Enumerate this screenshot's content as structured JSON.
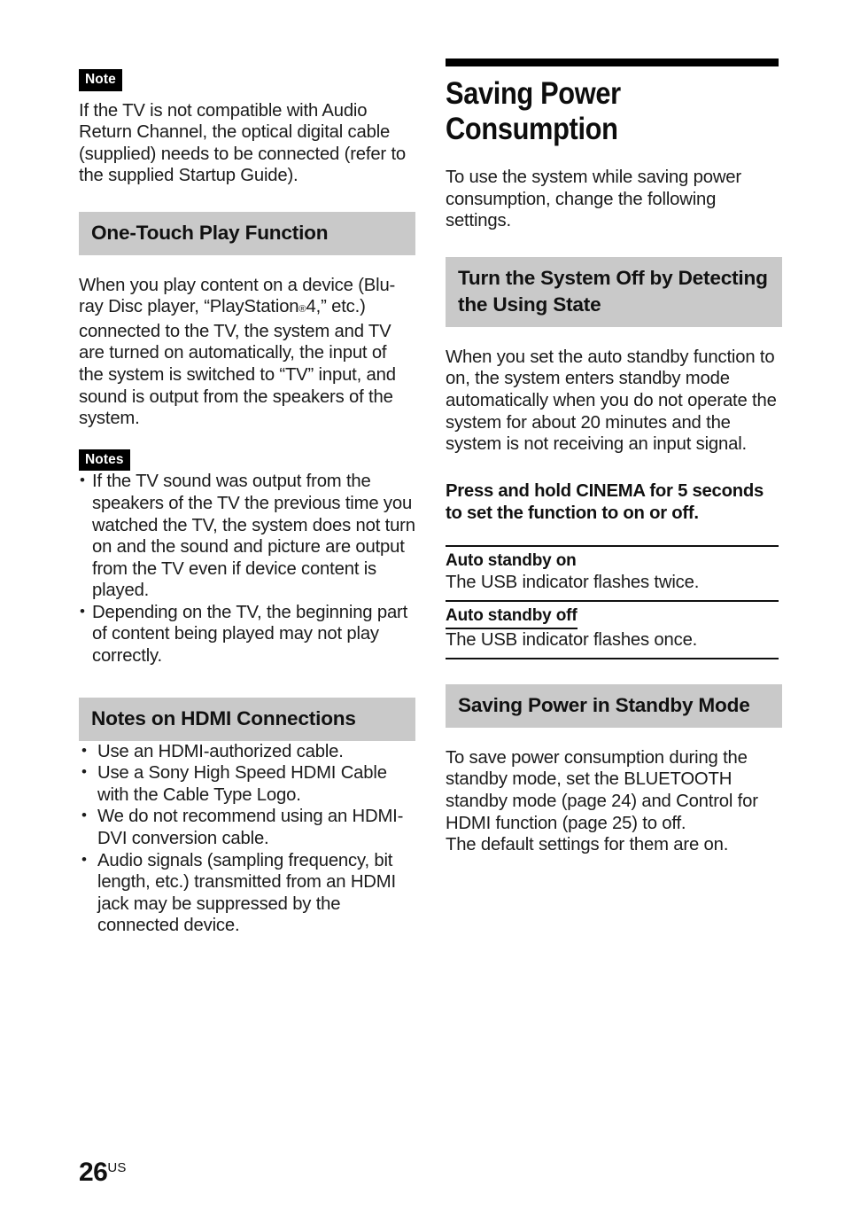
{
  "page": {
    "number": "26",
    "region_suffix": "US"
  },
  "left_column": {
    "note_tag": "Note",
    "note_body": "If the TV is not compatible with Audio Return Channel, the optical digital cable (supplied) needs to be connected (refer to the supplied Startup Guide).",
    "one_touch": {
      "heading": "One-Touch Play Function",
      "body_part1": "When you play content on a device (Blu-ray Disc player, “PlayStation",
      "body_regmark": "®",
      "body_part2": "4,” etc.) connected to the TV, the system and TV are turned on automatically, the input of the system is switched to “TV” input, and sound is output from the speakers of the system.",
      "notes_tag": "Notes",
      "notes": [
        "If the TV sound was output from the speakers of the TV the previous time you watched the TV, the system does not turn on and the sound and picture are output from the TV even if device content is played.",
        "Depending on the TV, the beginning part of content being played may not play correctly."
      ]
    },
    "hdmi": {
      "heading": "Notes on HDMI Connections",
      "bullets": [
        "Use an HDMI-authorized cable.",
        "Use a Sony High Speed HDMI Cable with the Cable Type Logo.",
        "We do not recommend using an HDMI-DVI conversion cable.",
        "Audio signals (sampling frequency, bit length, etc.) transmitted from an HDMI jack may be suppressed by the connected device."
      ]
    }
  },
  "right_column": {
    "chapter_title": "Saving Power Consumption",
    "chapter_intro": "To use the system while saving power consumption, change the following settings.",
    "auto_standby": {
      "heading": "Turn the System Off by Detecting the Using State",
      "body": "When you set the auto standby function to on, the system enters standby mode automatically when you do not operate the system for about 20 minutes and the system is not receiving an input signal.",
      "instruction": "Press and hold CINEMA for 5 seconds to set the function to on or off.",
      "table": [
        {
          "term": "Auto standby on",
          "desc": "The USB indicator flashes twice."
        },
        {
          "term": "Auto standby off",
          "desc": "The USB indicator flashes once."
        }
      ]
    },
    "standby_saving": {
      "heading": "Saving Power in Standby Mode",
      "body": "To save power consumption during the standby mode, set the BLUETOOTH standby mode (page 24) and Control for HDMI function (page 25) to off.\nThe default settings for them are on."
    }
  },
  "colors": {
    "heading_bar": "#c9c9c9",
    "rule": "#101010",
    "text": "#1b1b1b"
  }
}
